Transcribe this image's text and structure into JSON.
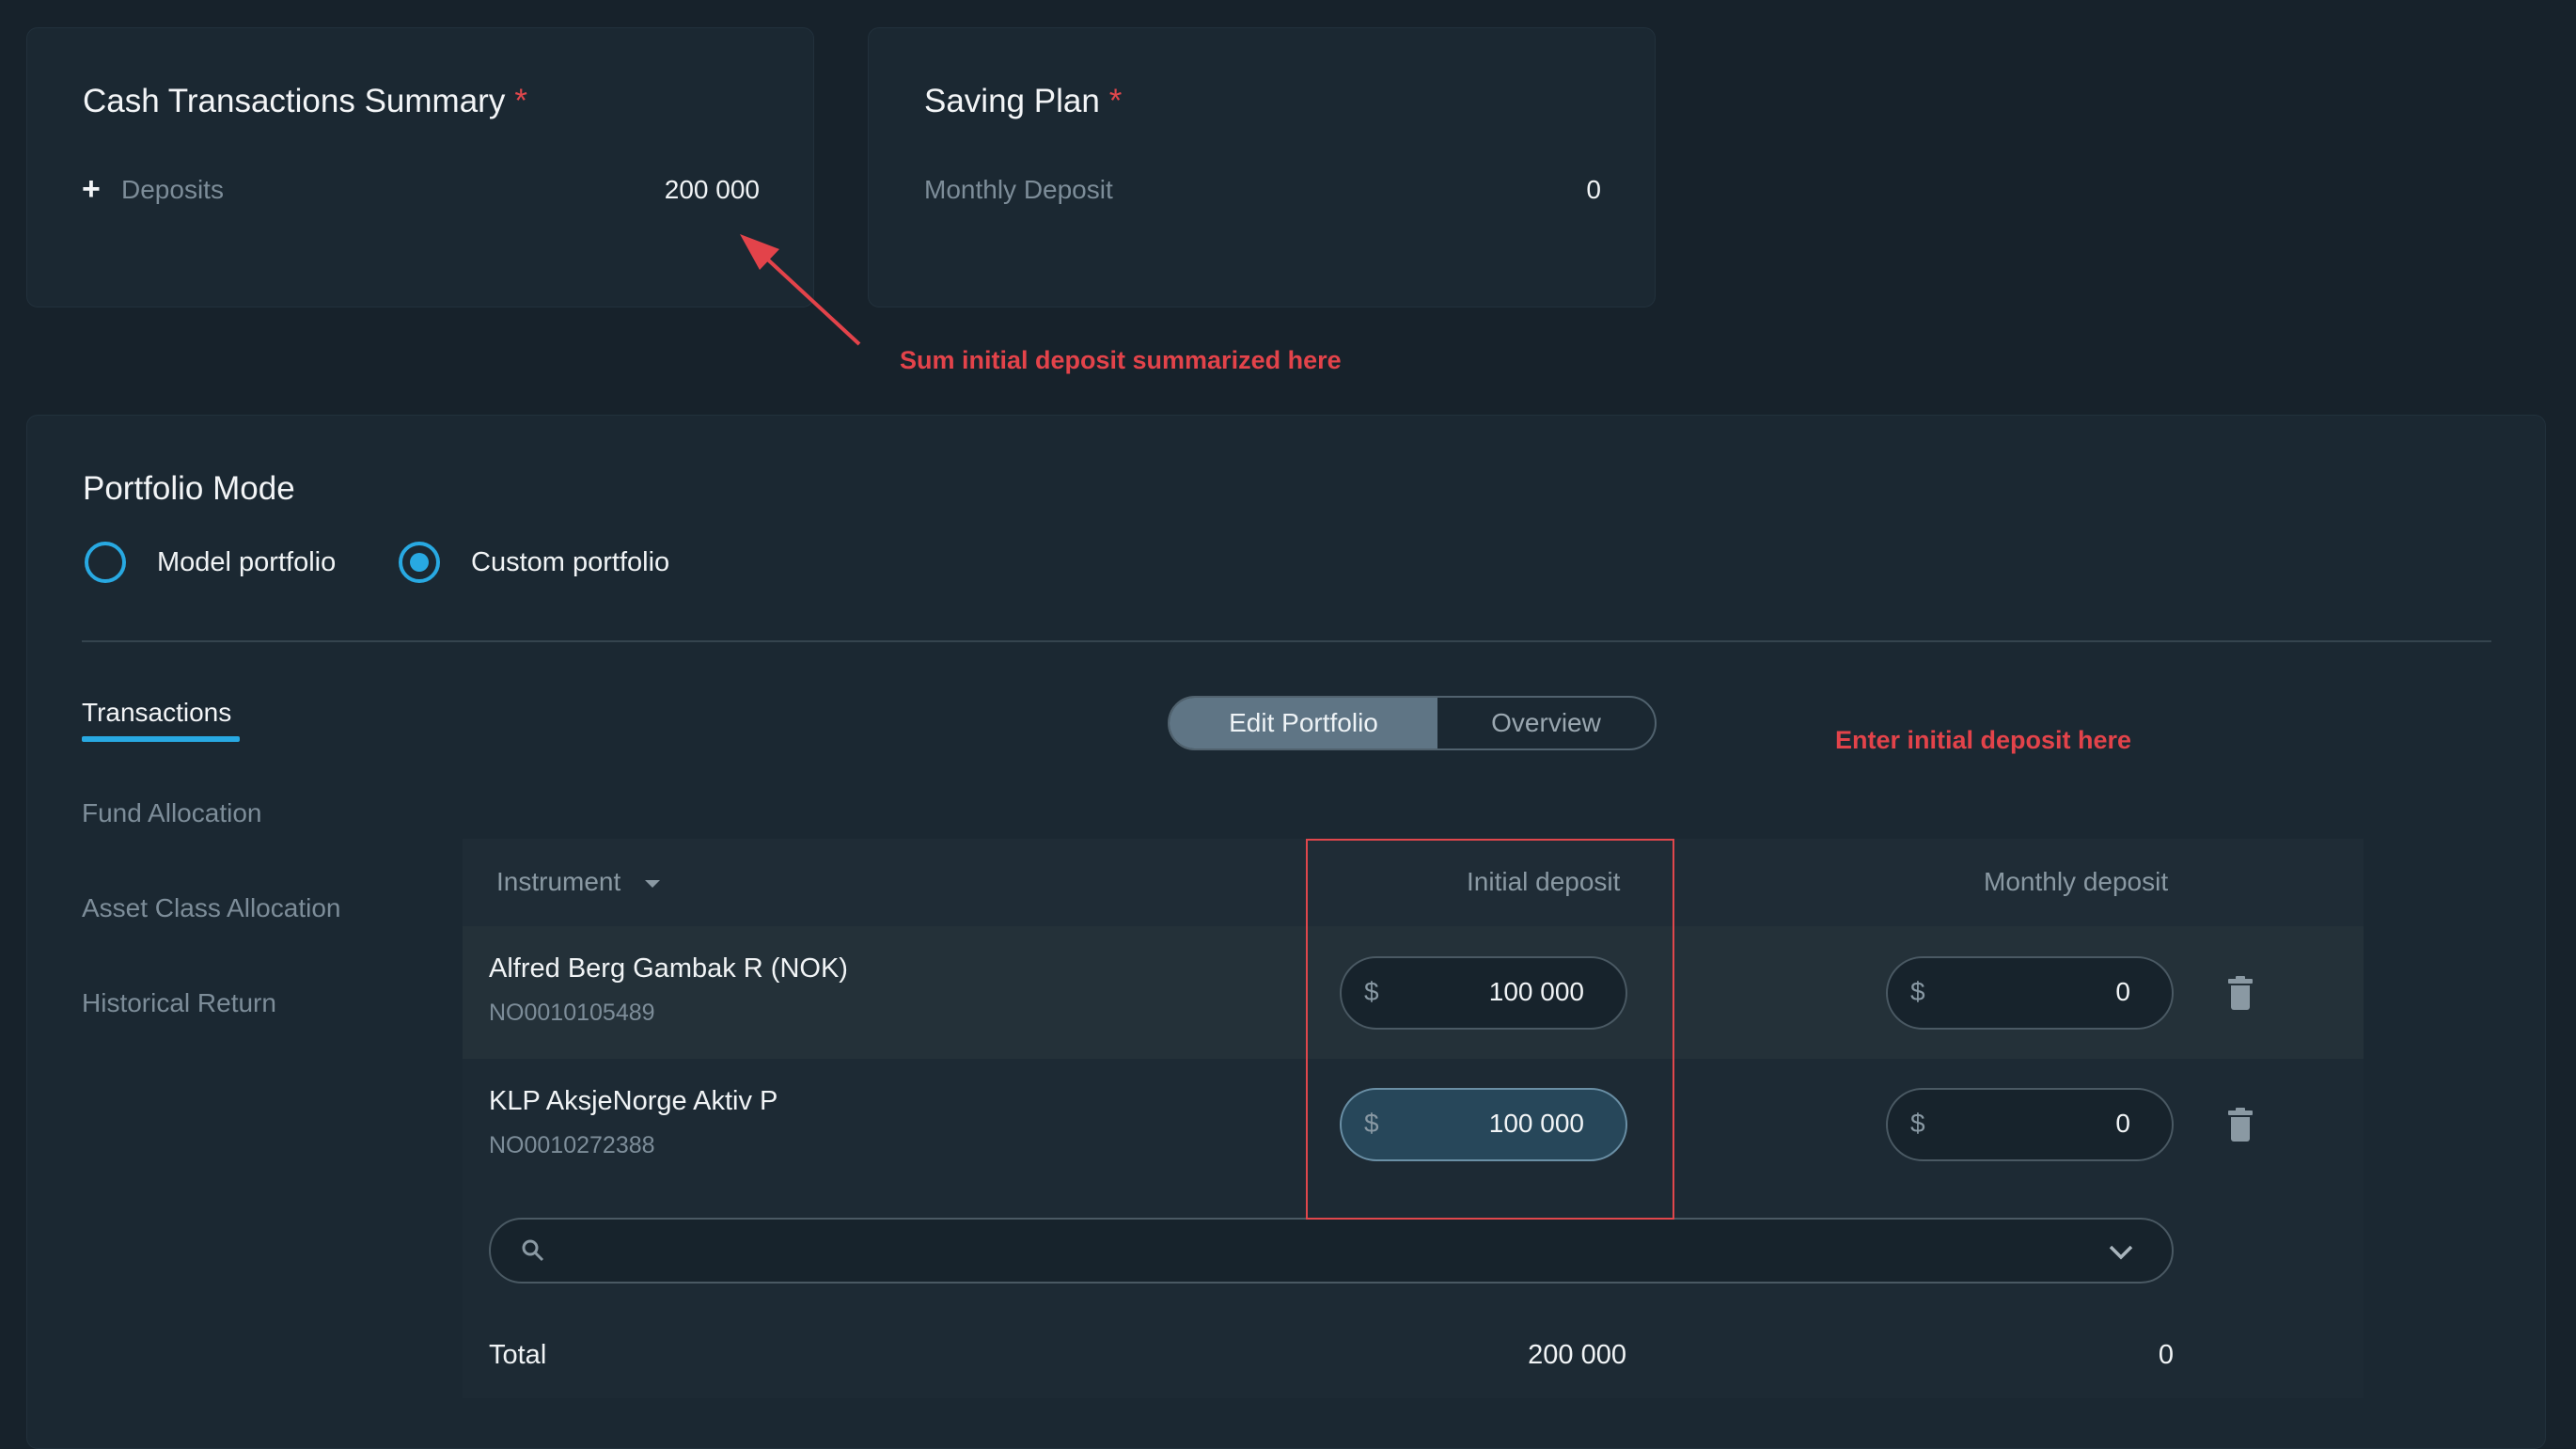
{
  "cash_summary": {
    "title": "Cash Transactions Summary",
    "required_mark": "*",
    "deposits_label": "Deposits",
    "deposits_value": "200 000",
    "expand_symbol": "+"
  },
  "saving_plan": {
    "title": "Saving Plan",
    "required_mark": "*",
    "monthly_label": "Monthly Deposit",
    "monthly_value": "0"
  },
  "annotations": {
    "sum_note": "Sum initial deposit summarized here",
    "enter_note": "Enter initial deposit here",
    "color": "#e3434a"
  },
  "portfolio_mode": {
    "title": "Portfolio Mode",
    "options": [
      {
        "label": "Model portfolio",
        "selected": false
      },
      {
        "label": "Custom portfolio",
        "selected": true
      }
    ]
  },
  "side_nav": {
    "items": [
      {
        "label": "Transactions",
        "active": true
      },
      {
        "label": "Fund Allocation",
        "active": false
      },
      {
        "label": "Asset Class Allocation",
        "active": false
      },
      {
        "label": "Historical Return",
        "active": false
      }
    ]
  },
  "view_toggle": {
    "edit_label": "Edit Portfolio",
    "overview_label": "Overview",
    "selected": "Edit Portfolio"
  },
  "table": {
    "headers": {
      "instrument": "Instrument",
      "initial": "Initial deposit",
      "monthly": "Monthly deposit"
    },
    "rows": [
      {
        "name": "Alfred Berg Gambak R (NOK)",
        "isin": "NO0010105489",
        "currency": "$",
        "initial": "100 000",
        "monthly": "0"
      },
      {
        "name": "KLP AksjeNorge Aktiv P",
        "isin": "NO0010272388",
        "currency": "$",
        "initial": "100 000",
        "monthly": "0"
      }
    ],
    "search_placeholder": "",
    "total_label": "Total",
    "total_initial": "200 000",
    "total_monthly": "0"
  },
  "colors": {
    "background": "#17222b",
    "card": "#1b2832",
    "accent": "#28a9e2",
    "required": "#e0474c"
  }
}
